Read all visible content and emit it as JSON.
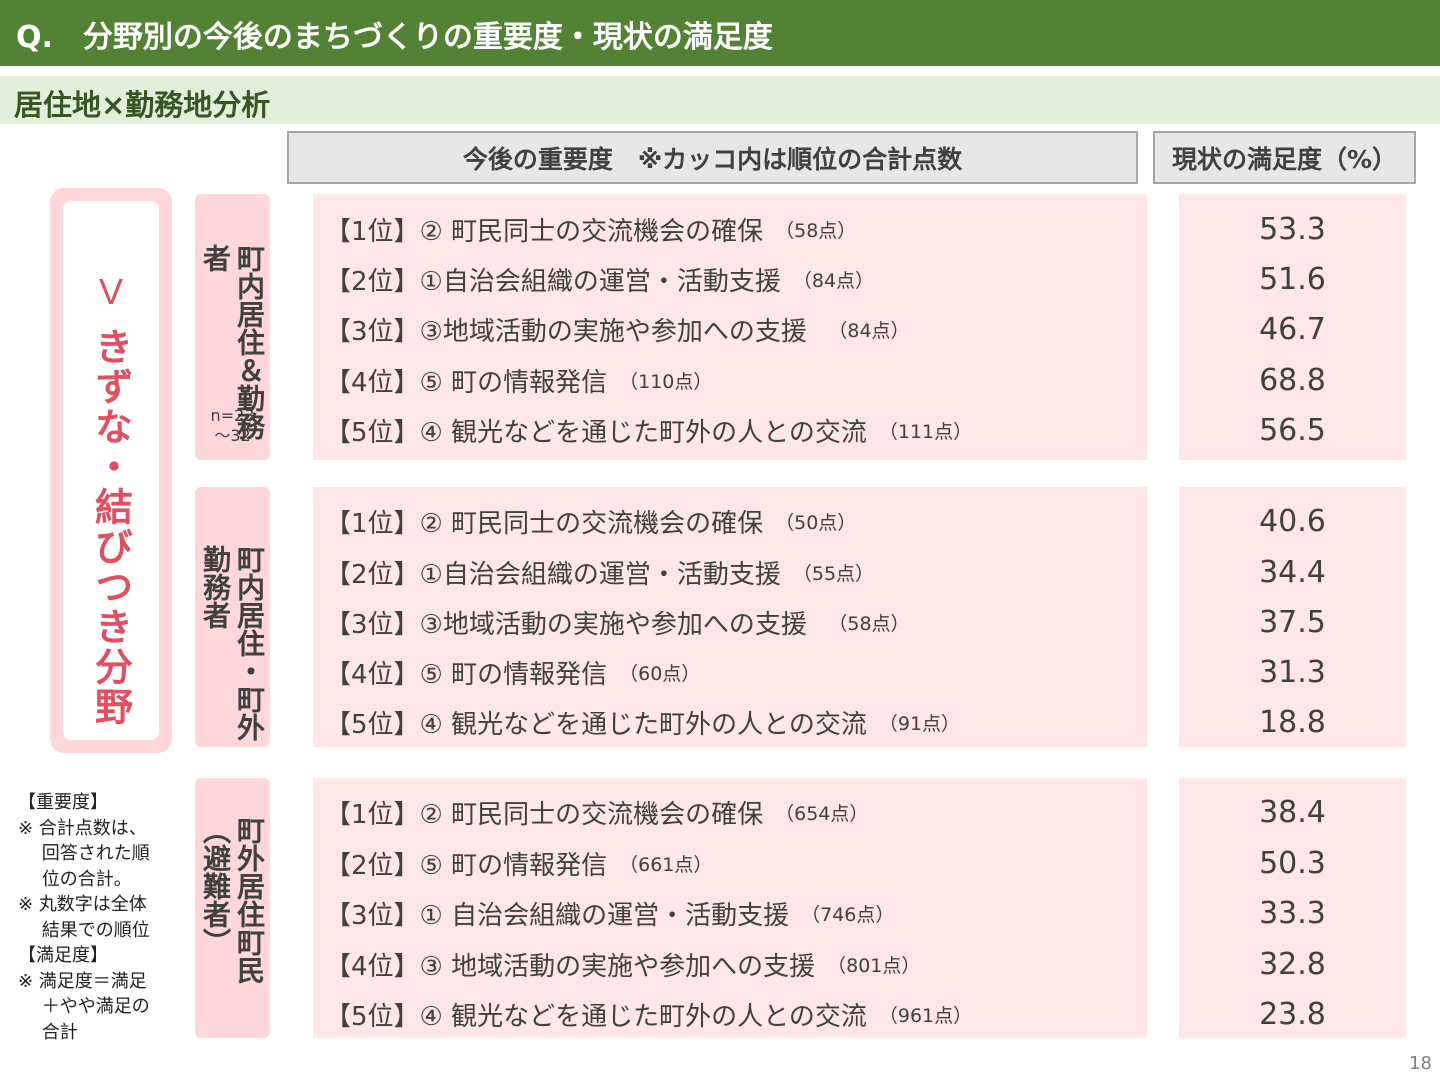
{
  "title": "Q.　分野別の今後のまちづくりの重要度・現状の満足度",
  "subtitle": "居住地×勤務地分析",
  "headers": {
    "importance": "今後の重要度　※カッコ内は順位の合計点数",
    "satisfaction": "現状の満足度（%）"
  },
  "category": {
    "roman": "V",
    "name": "きずな・結びつき分野"
  },
  "groups": [
    {
      "label": "町内居住＆勤務者",
      "n": [
        "n=23",
        "～32"
      ],
      "rows": [
        {
          "rank": "【1位】② 町民同士の交流機会の確保",
          "points": "（58点）",
          "satisfaction": "53.3"
        },
        {
          "rank": "【2位】①自治会組織の運営・活動支援",
          "points": "（84点）",
          "satisfaction": "51.6"
        },
        {
          "rank": "【3位】③地域活動の実施や参加への支援",
          "points": "　（84点）",
          "satisfaction": "46.7"
        },
        {
          "rank": "【4位】⑤ 町の情報発信",
          "points": "（110点）",
          "satisfaction": "68.8"
        },
        {
          "rank": "【5位】④ 観光などを通じた町外の人との交流",
          "points": "（111点）",
          "satisfaction": "56.5"
        }
      ]
    },
    {
      "label": "町内居住・町外勤務者",
      "rows": [
        {
          "rank": "【1位】② 町民同士の交流機会の確保",
          "points": "（50点）",
          "satisfaction": "40.6"
        },
        {
          "rank": "【2位】①自治会組織の運営・活動支援",
          "points": "（55点）",
          "satisfaction": "34.4"
        },
        {
          "rank": "【3位】③地域活動の実施や参加への支援",
          "points": "　（58点）",
          "satisfaction": "37.5"
        },
        {
          "rank": "【4位】⑤ 町の情報発信",
          "points": "（60点）",
          "satisfaction": "31.3"
        },
        {
          "rank": "【5位】④ 観光などを通じた町外の人との交流",
          "points": "（91点）",
          "satisfaction": "18.8"
        }
      ]
    },
    {
      "label": "町外居住町民（避難者）",
      "rows": [
        {
          "rank": "【1位】② 町民同士の交流機会の確保",
          "points": "（654点）",
          "satisfaction": "38.4"
        },
        {
          "rank": "【2位】⑤ 町の情報発信",
          "points": "（661点）",
          "satisfaction": "50.3"
        },
        {
          "rank": "【3位】① 自治会組織の運営・活動支援",
          "points": "（746点）",
          "satisfaction": "33.3"
        },
        {
          "rank": "【4位】③ 地域活動の実施や参加への支援",
          "points": "（801点）",
          "satisfaction": "32.8"
        },
        {
          "rank": "【5位】④ 観光などを通じた町外の人との交流",
          "points": "（961点）",
          "satisfaction": "23.8"
        }
      ]
    }
  ],
  "notes": [
    "【重要度】",
    "※ 合計点数は、",
    "　 回答された順",
    "　 位の合計。",
    "※ 丸数字は全体",
    "　 結果での順位",
    "【満足度】",
    "※ 満足度＝満足",
    "　 ＋やや満足の",
    "　 合計"
  ],
  "page_number": "18"
}
